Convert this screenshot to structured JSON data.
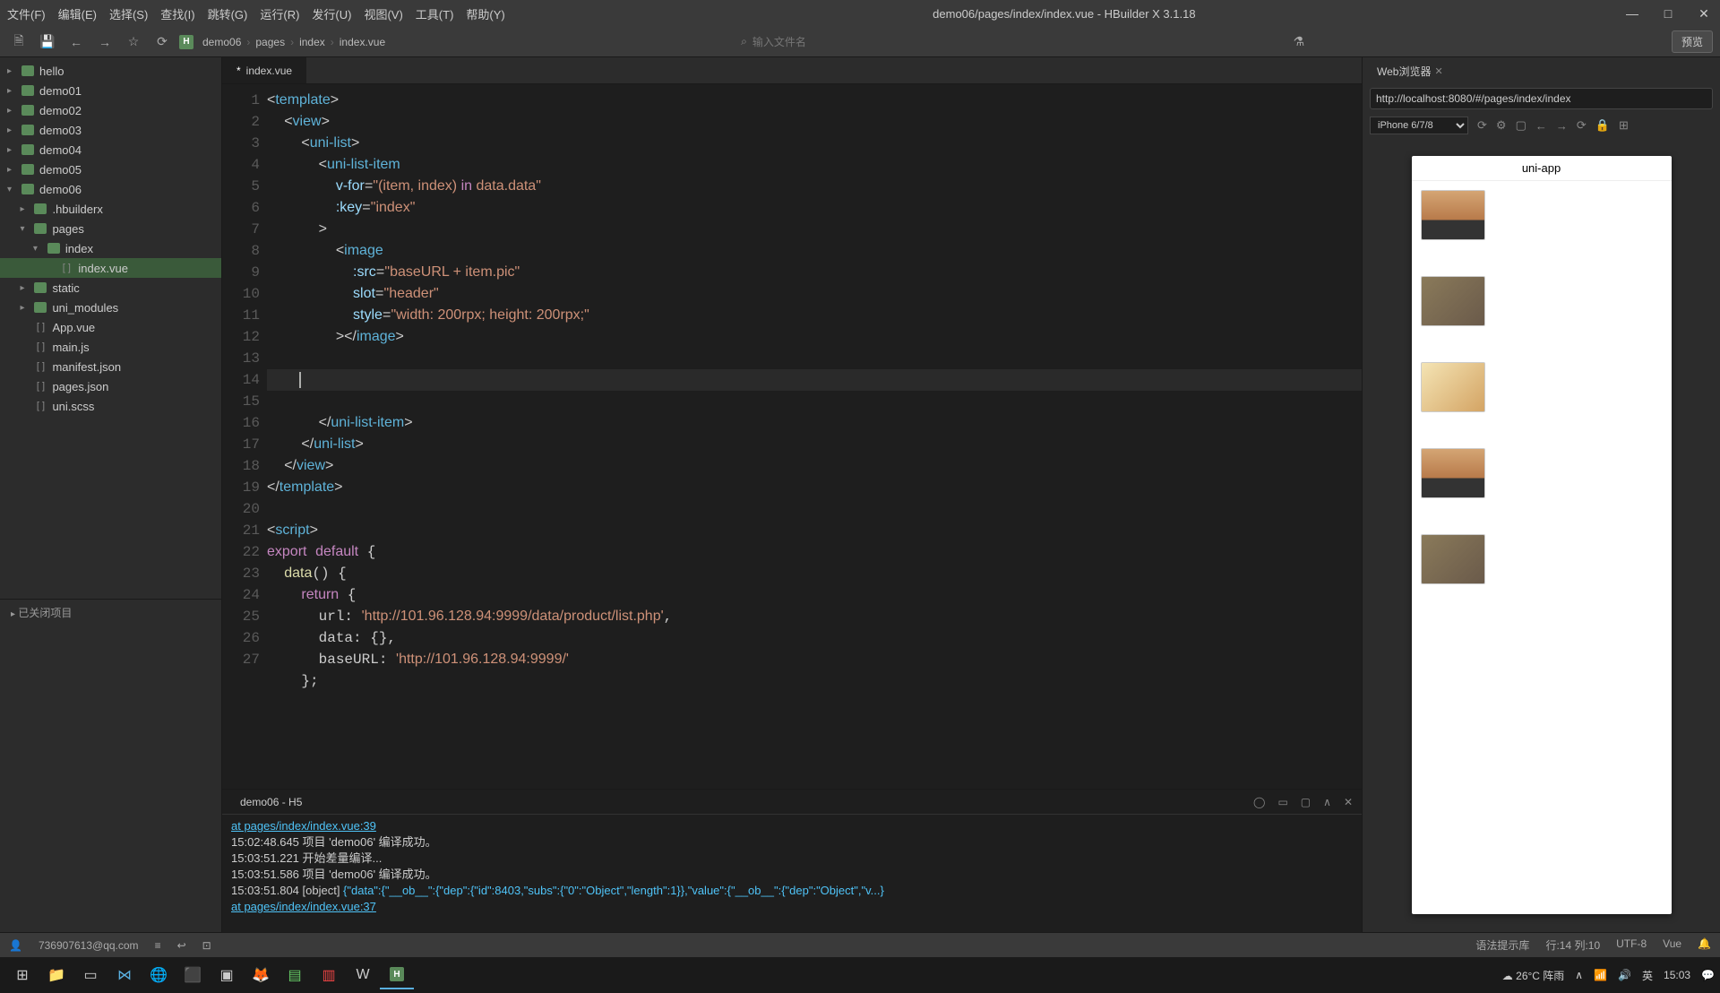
{
  "titlebar": {
    "menus": [
      "文件(F)",
      "编辑(E)",
      "选择(S)",
      "查找(I)",
      "跳转(G)",
      "运行(R)",
      "发行(U)",
      "视图(V)",
      "工具(T)",
      "帮助(Y)"
    ],
    "title": "demo06/pages/index/index.vue - HBuilder X 3.1.18"
  },
  "toolbar": {
    "breadcrumb": [
      "demo06",
      "pages",
      "index",
      "index.vue"
    ],
    "search_placeholder": "输入文件名",
    "preview": "预览"
  },
  "sidebar": {
    "tree": [
      {
        "level": 0,
        "arrow": "▸",
        "type": "folder",
        "name": "hello"
      },
      {
        "level": 0,
        "arrow": "▸",
        "type": "folder",
        "name": "demo01"
      },
      {
        "level": 0,
        "arrow": "▸",
        "type": "folder",
        "name": "demo02"
      },
      {
        "level": 0,
        "arrow": "▸",
        "type": "folder",
        "name": "demo03"
      },
      {
        "level": 0,
        "arrow": "▸",
        "type": "folder",
        "name": "demo04"
      },
      {
        "level": 0,
        "arrow": "▸",
        "type": "folder",
        "name": "demo05"
      },
      {
        "level": 0,
        "arrow": "▾",
        "type": "folder",
        "name": "demo06",
        "selected": false
      },
      {
        "level": 1,
        "arrow": "▸",
        "type": "folder",
        "name": ".hbuilderx"
      },
      {
        "level": 1,
        "arrow": "▾",
        "type": "folder",
        "name": "pages"
      },
      {
        "level": 2,
        "arrow": "▾",
        "type": "folder",
        "name": "index"
      },
      {
        "level": 3,
        "arrow": "",
        "type": "file",
        "name": "index.vue",
        "selected": true
      },
      {
        "level": 1,
        "arrow": "▸",
        "type": "folder",
        "name": "static"
      },
      {
        "level": 1,
        "arrow": "▸",
        "type": "folder",
        "name": "uni_modules"
      },
      {
        "level": 1,
        "arrow": "",
        "type": "file",
        "name": "App.vue"
      },
      {
        "level": 1,
        "arrow": "",
        "type": "file",
        "name": "main.js"
      },
      {
        "level": 1,
        "arrow": "",
        "type": "file",
        "name": "manifest.json"
      },
      {
        "level": 1,
        "arrow": "",
        "type": "file",
        "name": "pages.json"
      },
      {
        "level": 1,
        "arrow": "",
        "type": "file",
        "name": "uni.scss"
      }
    ],
    "closed": "已关闭项目"
  },
  "editor": {
    "tab": "index.vue",
    "tab_dirty": "*",
    "line_numbers": [
      "1",
      "2",
      "3",
      "4",
      "5",
      "6",
      "7",
      "8",
      "9",
      "10",
      "11",
      "12",
      "13",
      "14",
      "15",
      "16",
      "17",
      "18",
      "19",
      "20",
      "21",
      "22",
      "23",
      "24",
      "25",
      "26",
      "27"
    ],
    "code_html": "<span class='brace'>&lt;</span><span class='tag'>template</span><span class='brace'>&gt;</span>\n  <span class='brace'>&lt;</span><span class='tag'>view</span><span class='brace'>&gt;</span>\n    <span class='brace'>&lt;</span><span class='tag'>uni-list</span><span class='brace'>&gt;</span>\n      <span class='brace'>&lt;</span><span class='tag'>uni-list-item</span>\n        <span class='attr'>v-for</span>=<span class='str'>\"(item, index) </span><span class='kw'>in</span><span class='str'> data.data\"</span>\n        <span class='attr'>:key</span>=<span class='str'>\"index\"</span>\n      <span class='brace'>&gt;</span>\n        <span class='brace'>&lt;</span><span class='tag'>image</span>\n          <span class='attr'>:src</span>=<span class='str'>\"baseURL + item.pic\"</span>\n          <span class='attr'>slot</span>=<span class='str'>\"header\"</span>\n          <span class='attr'>style</span>=<span class='str'>\"width: 200rpx; height: 200rpx;\"</span>\n        <span class='brace'>&gt;&lt;/</span><span class='tag'>image</span><span class='brace'>&gt;</span>\n\n<span class='line-active'>        <span class='cursor'></span></span>\n      <span class='brace'>&lt;/</span><span class='tag'>uni-list-item</span><span class='brace'>&gt;</span>\n    <span class='brace'>&lt;/</span><span class='tag'>uni-list</span><span class='brace'>&gt;</span>\n  <span class='brace'>&lt;/</span><span class='tag'>view</span><span class='brace'>&gt;</span>\n<span class='brace'>&lt;/</span><span class='tag'>template</span><span class='brace'>&gt;</span>\n\n<span class='brace'>&lt;</span><span class='tag'>script</span><span class='brace'>&gt;</span>\n<span class='kw'>export</span> <span class='kw'>default</span> {\n  <span class='fn'>data</span>() {\n    <span class='kw'>return</span> {\n      url: <span class='str'>'http://101.96.128.94:9999/data/product/list.php'</span>,\n      data: {},\n      baseURL: <span class='str'>'http://101.96.128.94:9999/'</span>\n    };"
  },
  "terminal": {
    "tab": "demo06 - H5",
    "lines": [
      {
        "type": "link",
        "text": "at pages/index/index.vue:39"
      },
      {
        "type": "text",
        "text": "15:02:48.645 项目 'demo06' 编译成功。"
      },
      {
        "type": "text",
        "text": "15:03:51.221 开始差量编译..."
      },
      {
        "type": "text",
        "text": "15:03:51.586 项目 'demo06' 编译成功。"
      },
      {
        "type": "obj",
        "text": "15:03:51.804 [object] {\"data\":{\"__ob__\":{\"dep\":{\"id\":8403,\"subs\":{\"0\":\"Object\",\"length\":1}},\"value\":{\"__ob__\":{\"dep\":\"Object\",\"v...}"
      },
      {
        "type": "link",
        "text": "at pages/index/index.vue:37"
      }
    ]
  },
  "preview": {
    "tab": "Web浏览器",
    "url": "http://localhost:8080/#/pages/index/index",
    "device": "iPhone 6/7/8",
    "app_title": "uni-app",
    "items": [
      "mac",
      "dark",
      "anime",
      "mac",
      "dark"
    ]
  },
  "statusbar": {
    "user": "736907613@qq.com",
    "syntax": "语法提示库",
    "pos": "行:14  列:10",
    "encoding": "UTF-8",
    "lang": "Vue"
  },
  "taskbar": {
    "weather": "26°C 阵雨",
    "time": "15:03",
    "ime": "英"
  }
}
